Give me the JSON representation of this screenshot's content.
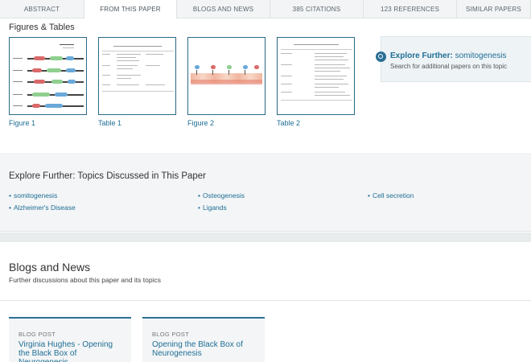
{
  "tabs": [
    {
      "label": "ABSTRACT"
    },
    {
      "label": "FROM THIS PAPER"
    },
    {
      "label": "BLOGS AND NEWS"
    },
    {
      "label": "385 CITATIONS"
    },
    {
      "label": "123 REFERENCES"
    },
    {
      "label": "SIMILAR PAPERS"
    }
  ],
  "figures": {
    "title": "Figures & Tables",
    "items": [
      {
        "caption": "Figure 1"
      },
      {
        "caption": "Table 1"
      },
      {
        "caption": "Figure 2"
      },
      {
        "caption": "Table 2"
      }
    ]
  },
  "explore": {
    "label": "Explore Further:",
    "topic": "somitogenesis",
    "subtitle": "Search for additional papers on this topic"
  },
  "topics": {
    "title": "Explore Further: Topics Discussed in This Paper",
    "items": [
      {
        "label": "somitogenesis"
      },
      {
        "label": "Osteogenesis"
      },
      {
        "label": "Cell secretion"
      },
      {
        "label": "Alzheimer's Disease"
      },
      {
        "label": "Ligands"
      }
    ]
  },
  "blogs": {
    "title": "Blogs and News",
    "subtitle": "Further discussions about this paper and its topics",
    "posts": [
      {
        "label": "BLOG POST",
        "title": "Virginia Hughes - Opening the Black Box of Neurogenesis"
      },
      {
        "label": "BLOG POST",
        "title": "Opening the Black Box of Neurogenesis"
      }
    ]
  },
  "colors": {
    "accent": "#1f6e95",
    "border": "#2a6a86"
  }
}
